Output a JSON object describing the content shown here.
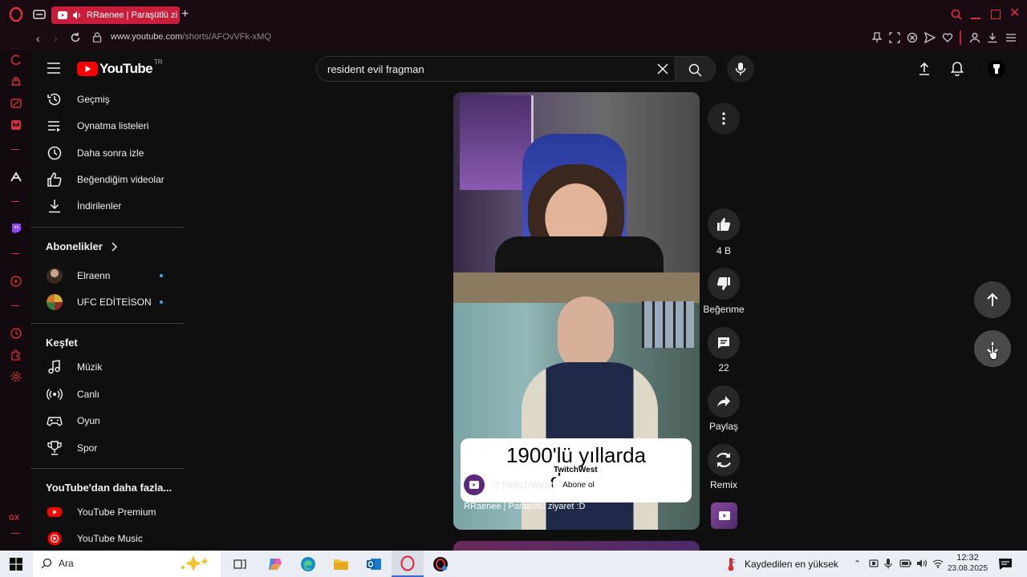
{
  "browser": {
    "tab_title": "RRaenee | Paraşütlü zi",
    "url_domain": "www.youtube.com",
    "url_path": "/shorts/AFOvVFk-xMQ"
  },
  "youtube": {
    "logo_text": "YouTube",
    "region": "TR",
    "search_value": "resident evil fragman",
    "sidebar": {
      "library_items": [
        {
          "label": "Geçmiş",
          "icon": "history-icon"
        },
        {
          "label": "Oynatma listeleri",
          "icon": "playlist-icon"
        },
        {
          "label": "Daha sonra izle",
          "icon": "clock-icon"
        },
        {
          "label": "Beğendiğim videolar",
          "icon": "thumbs-up-icon"
        },
        {
          "label": "İndirilenler",
          "icon": "download-icon"
        }
      ],
      "subscriptions_title": "Abonelikler",
      "subscriptions": [
        {
          "label": "Elraenn"
        },
        {
          "label": "UFC EDİTEİSON"
        }
      ],
      "explore_title": "Keşfet",
      "explore_items": [
        {
          "label": "Müzik",
          "icon": "music-icon"
        },
        {
          "label": "Canlı",
          "icon": "live-icon"
        },
        {
          "label": "Oyun",
          "icon": "gaming-icon"
        },
        {
          "label": "Spor",
          "icon": "trophy-icon"
        }
      ],
      "more_title": "YouTube'dan daha fazla...",
      "more_items": [
        {
          "label": "YouTube Premium"
        },
        {
          "label": "YouTube Music"
        }
      ]
    },
    "short": {
      "caption_line1": "1900'lü yıllarda",
      "caption_line2": "d   m:",
      "watermark": "TwitchWest",
      "channel": "@TwitchWest",
      "subscribe_label": "Abone ol",
      "title": "RRaenee | Paraşütlü ziyaret :D"
    },
    "actions": {
      "likes": "4 B",
      "dislike_label": "Beğenme",
      "comments": "22",
      "share_label": "Paylaş",
      "remix_label": "Remix"
    }
  },
  "taskbar": {
    "search_placeholder": "Ara",
    "weather_text": "Kaydedilen en yüksek",
    "time": "12:32",
    "date": "23.08.2025"
  },
  "colors": {
    "opera_red": "#c81e3c",
    "yt_red": "#ff0000",
    "bg": "#0f0f0f"
  }
}
